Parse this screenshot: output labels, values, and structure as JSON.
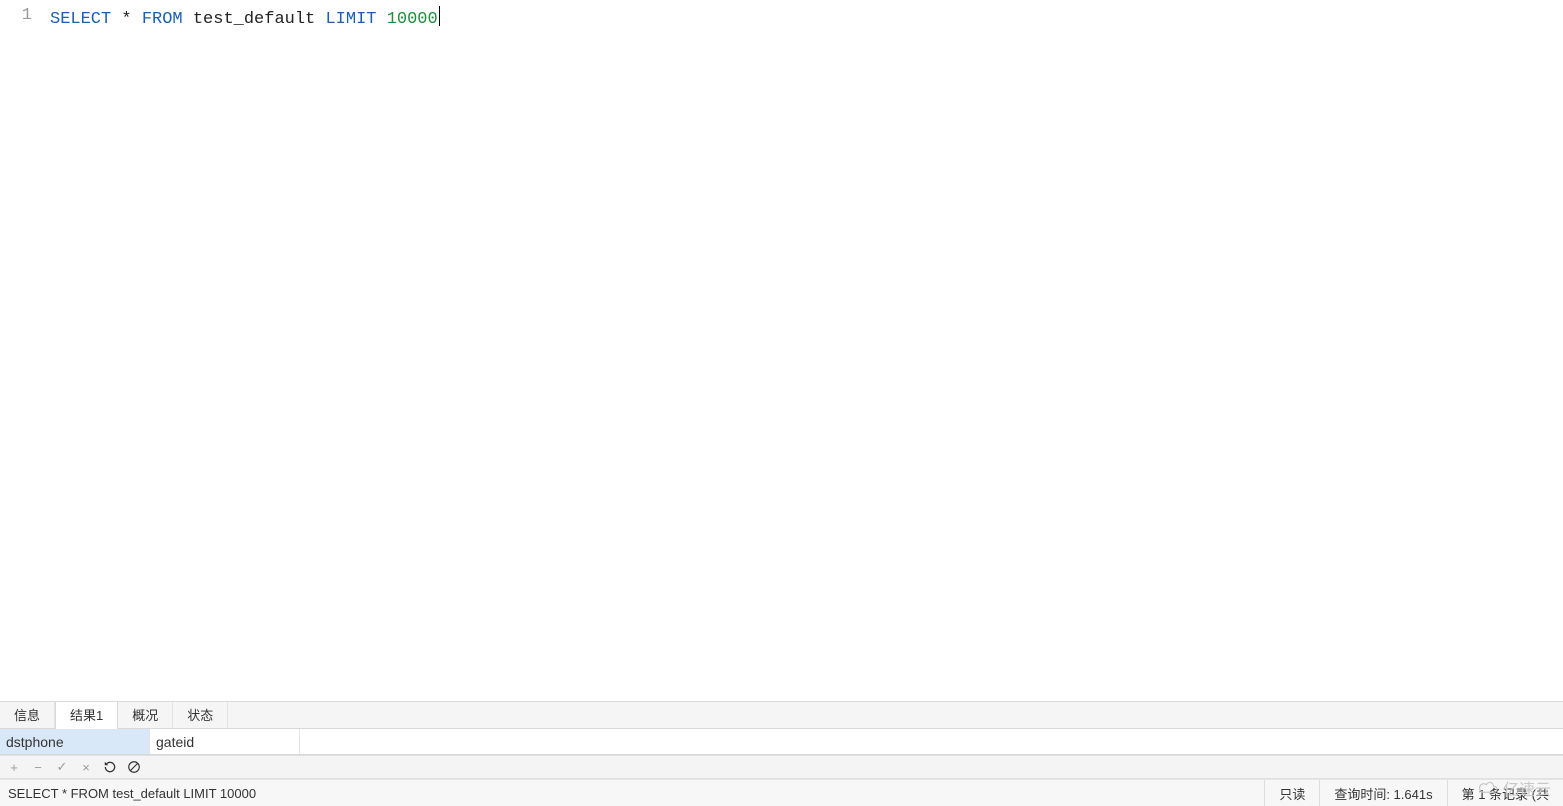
{
  "editor": {
    "line_number": "1",
    "sql_tokens": {
      "select": "SELECT",
      "star": " * ",
      "from": "FROM",
      "table": " test_default ",
      "limit": "LIMIT",
      "sp": " ",
      "num": "10000"
    }
  },
  "tabs": {
    "items": [
      {
        "label": "信息",
        "active": false
      },
      {
        "label": "结果1",
        "active": true
      },
      {
        "label": "概况",
        "active": false
      },
      {
        "label": "状态",
        "active": false
      }
    ]
  },
  "grid": {
    "columns": [
      {
        "name": "dstphone",
        "selected": true
      },
      {
        "name": "gateid",
        "selected": false
      }
    ]
  },
  "toolbar": {
    "add": "+",
    "remove": "−",
    "commit": "✓",
    "cancel": "×",
    "refresh": "",
    "stop": ""
  },
  "statusbar": {
    "query": "SELECT * FROM test_default LIMIT 10000",
    "readonly": "只读",
    "time": "查询时间: 1.641s",
    "record": "第 1 条记录 (共"
  },
  "watermark": {
    "text": "亿速云"
  }
}
